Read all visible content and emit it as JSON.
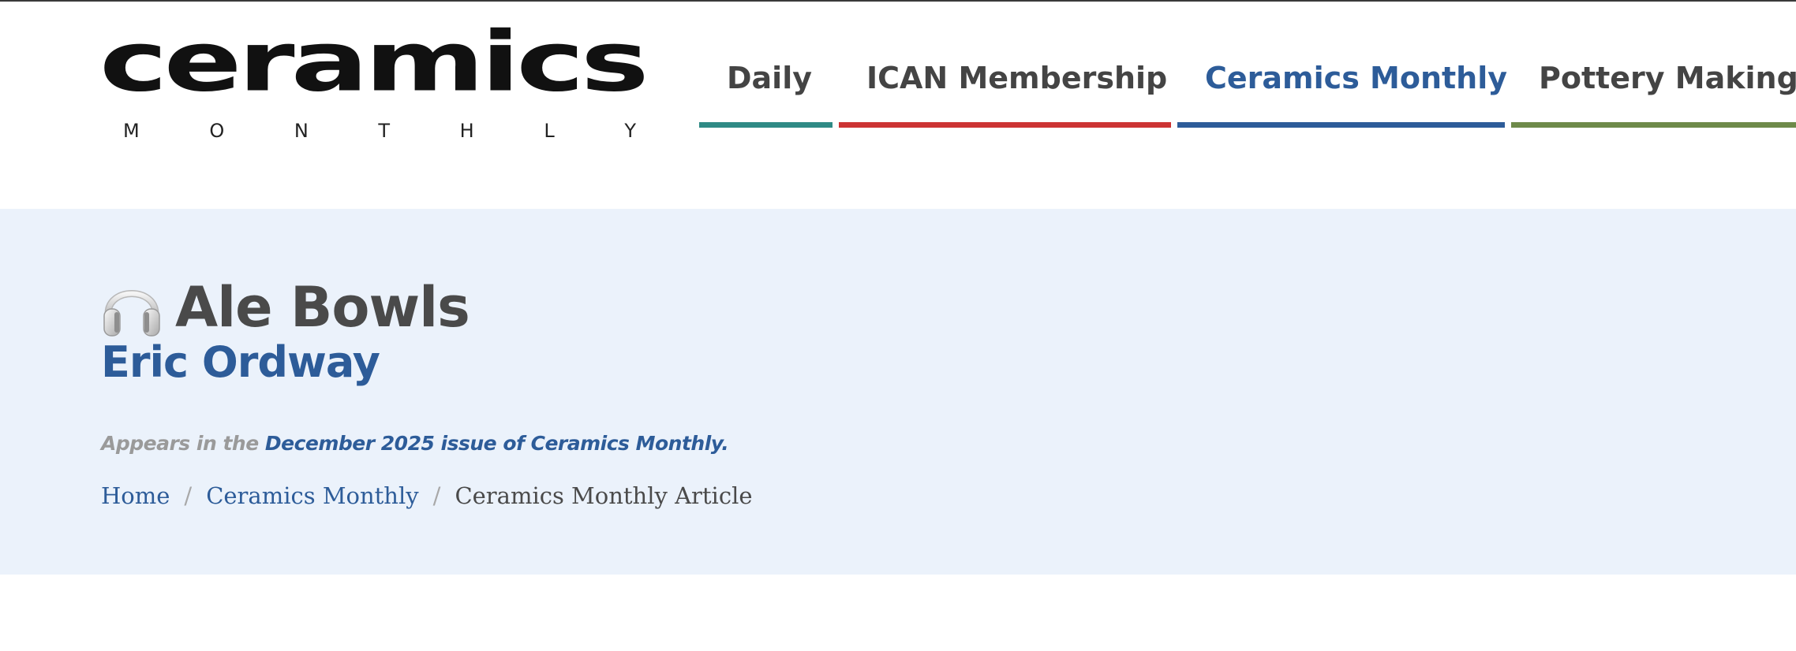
{
  "header": {
    "logo": {
      "word": "ceramics",
      "sub_letters": [
        "M",
        "O",
        "N",
        "T",
        "H",
        "L",
        "Y"
      ]
    },
    "nav": [
      {
        "label": "Daily",
        "color": "#2f8a85"
      },
      {
        "label": "ICAN Membership",
        "color": "#cc3333"
      },
      {
        "label": "Ceramics Monthly",
        "color": "#2d5c99",
        "active": true
      },
      {
        "label": "Pottery Making Il",
        "color": "#6e8a4a"
      }
    ]
  },
  "article": {
    "icon": "headphones-icon",
    "title": "Ale Bowls",
    "author": "Eric Ordway",
    "appears_prefix": "Appears in the ",
    "appears_issue": "December 2025 issue of Ceramics Monthly."
  },
  "breadcrumb": {
    "items": [
      "Home",
      "Ceramics Monthly"
    ],
    "separator": "/",
    "current": "Ceramics Monthly Article"
  },
  "colors": {
    "accent": "#2d5c99",
    "hero_background": "#ebf2fb",
    "title_text": "#4a4a4a"
  }
}
